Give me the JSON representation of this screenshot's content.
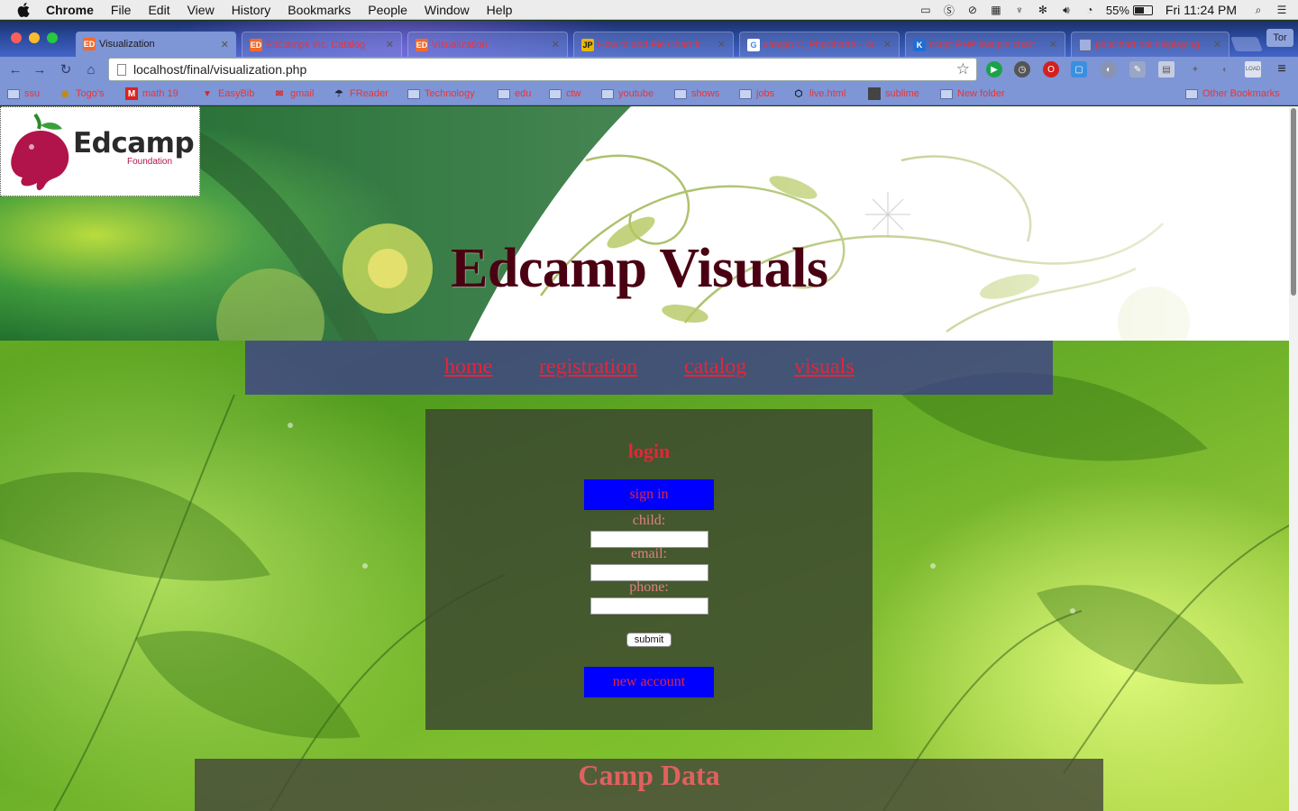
{
  "menubar": {
    "app": "Chrome",
    "items": [
      "File",
      "Edit",
      "View",
      "History",
      "Bookmarks",
      "People",
      "Window",
      "Help"
    ],
    "battery": "55%",
    "clock": "Fri 11:24 PM"
  },
  "tabs": [
    {
      "label": "Visualization",
      "favicon": "edcamp-icon",
      "active": true
    },
    {
      "label": "EdCamps Inc. Catalog",
      "favicon": "edcamp-icon",
      "active": false
    },
    {
      "label": "Visualization",
      "favicon": "edcamp-icon",
      "active": false
    },
    {
      "label": "How to add Pie Chart fr",
      "favicon": "jp-icon",
      "active": false
    },
    {
      "label": "xampp C_PhpChartX - G",
      "favicon": "google-icon",
      "active": false
    },
    {
      "label": "script PHP bwt pie chart",
      "favicon": "k-icon",
      "active": false
    },
    {
      "label": "phpChart not displaying",
      "favicon": "page-icon",
      "active": false
    }
  ],
  "profile": "Tor",
  "address_bar": {
    "url": "localhost/final/visualization.php"
  },
  "bookmarks": [
    {
      "label": "ssu",
      "icon": "folder"
    },
    {
      "label": "Togo's",
      "icon": "togos-icon"
    },
    {
      "label": "math 19",
      "icon": "gmail-m-icon"
    },
    {
      "label": "EasyBib",
      "icon": "easybib-icon"
    },
    {
      "label": "gmail",
      "icon": "gmail-icon"
    },
    {
      "label": "FReader",
      "icon": "freader-icon"
    },
    {
      "label": "Technology",
      "icon": "folder"
    },
    {
      "label": "edu",
      "icon": "folder"
    },
    {
      "label": "ctw",
      "icon": "folder"
    },
    {
      "label": "youtube",
      "icon": "folder"
    },
    {
      "label": "shows",
      "icon": "folder"
    },
    {
      "label": "jobs",
      "icon": "folder"
    },
    {
      "label": "live.html",
      "icon": "codepen-icon"
    },
    {
      "label": "sublime",
      "icon": "sublime-icon"
    },
    {
      "label": "New folder",
      "icon": "folder"
    },
    {
      "label": "Other Bookmarks",
      "icon": "folder"
    }
  ],
  "site": {
    "logo_text": "Edcamp",
    "logo_sub": "Foundation",
    "title": "Edcamp Visuals",
    "nav": [
      "home",
      "registration",
      "catalog",
      "visuals"
    ]
  },
  "login": {
    "title": "login",
    "sign_in": "sign in",
    "child_label": "child:",
    "email_label": "email:",
    "phone_label": "phone:",
    "child_value": "",
    "email_value": "",
    "phone_value": "",
    "submit": "submit",
    "new_account": "new account"
  },
  "camp": {
    "title": "Camp Data"
  },
  "colors": {
    "link_red": "#e3263a",
    "title_maroon": "#4a0012",
    "button_blue": "#0000ff",
    "nav_purple": "#3a3496"
  }
}
